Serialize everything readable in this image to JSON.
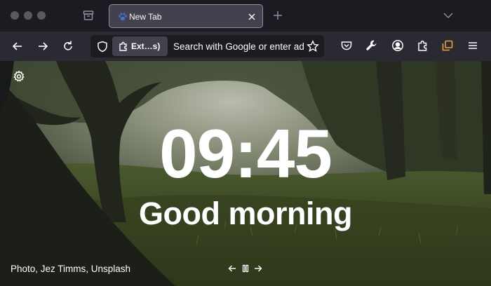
{
  "tab": {
    "title": "New Tab",
    "favicon": "paw-icon"
  },
  "urlbar": {
    "extension_label": "Ext…s)",
    "placeholder": "Search with Google or enter address",
    "icon": "shield-icon"
  },
  "toolbar": {
    "buttons": [
      "back-icon",
      "forward-icon",
      "reload-icon",
      "pocket-icon",
      "wrench-icon",
      "account-icon",
      "extensions-icon",
      "tab-extension-icon",
      "menu-icon"
    ]
  },
  "newtab": {
    "time": "09:45",
    "greeting": "Good morning",
    "photo_credit": "Photo, Jez Timms, Unsplash"
  },
  "colors": {
    "tabstrip": "#1c1b22",
    "navbar": "#2b2a33",
    "selected_tab": "#42414d",
    "icon": "#fbfbfe",
    "accent_orange": "#e8a23a"
  }
}
